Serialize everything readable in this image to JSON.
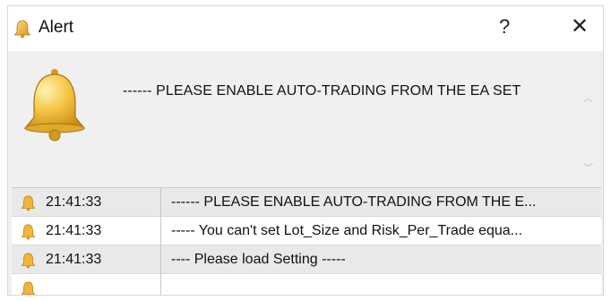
{
  "window": {
    "title": "Alert",
    "help_label": "?",
    "close_label": "✕"
  },
  "message": {
    "text": "------ PLEASE ENABLE AUTO-TRADING FROM THE EA SET"
  },
  "scroll": {
    "up": "︿",
    "down": "﹀"
  },
  "alerts": [
    {
      "time": "21:41:33",
      "message": "------ PLEASE ENABLE AUTO-TRADING FROM THE E..."
    },
    {
      "time": "21:41:33",
      "message": "----- You can't set Lot_Size and Risk_Per_Trade equa..."
    },
    {
      "time": "21:41:33",
      "message": "---- Please load Setting -----"
    }
  ],
  "icons": {
    "bell": "bell-icon",
    "bell_color": "#f2b53a"
  }
}
